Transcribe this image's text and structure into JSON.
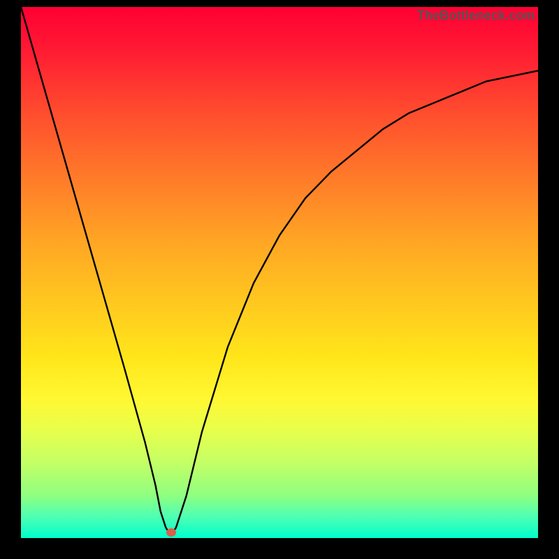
{
  "watermark": "TheBottleneck.com",
  "marker": {
    "x_pct": 29,
    "y_pct": 99
  },
  "chart_data": {
    "type": "line",
    "title": "",
    "xlabel": "",
    "ylabel": "",
    "xlim": [
      0,
      100
    ],
    "ylim": [
      0,
      100
    ],
    "series": [
      {
        "name": "bottleneck-curve",
        "x": [
          0,
          5,
          10,
          15,
          20,
          24,
          26,
          27,
          28,
          29,
          30,
          32,
          35,
          40,
          45,
          50,
          55,
          60,
          65,
          70,
          75,
          80,
          85,
          90,
          95,
          100
        ],
        "values": [
          100,
          83,
          66,
          49,
          32,
          18,
          10,
          5,
          2,
          0.5,
          2,
          8,
          20,
          36,
          48,
          57,
          64,
          69,
          73,
          77,
          80,
          82,
          84,
          86,
          87,
          88
        ]
      }
    ],
    "annotations": []
  }
}
